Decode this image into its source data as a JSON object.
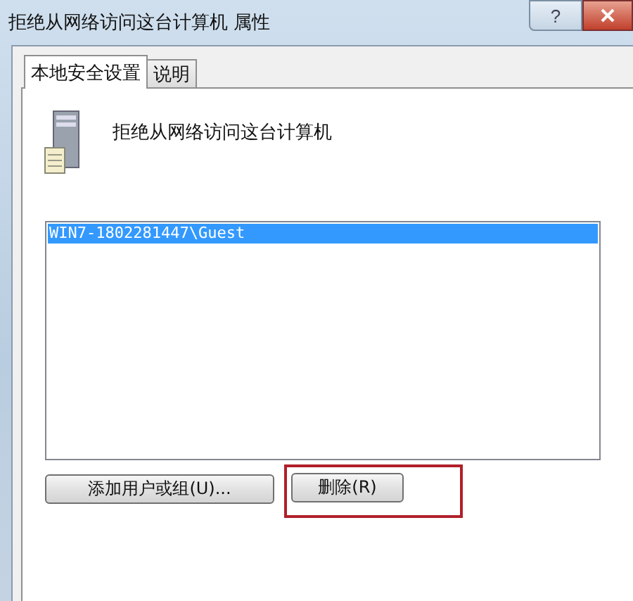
{
  "window": {
    "title": "拒绝从网络访问这台计算机 属性",
    "help_button": "?"
  },
  "tabs": [
    {
      "label": "本地安全设置",
      "selected": true
    },
    {
      "label": "说明",
      "selected": false
    }
  ],
  "policy": {
    "name": "拒绝从网络访问这台计算机"
  },
  "accounts": [
    {
      "name": "WIN7-1802281447\\Guest",
      "selected": true
    }
  ],
  "buttons": [
    {
      "label": "添加用户或组(U)...",
      "highlighted": false
    },
    {
      "label": "删除(R)",
      "highlighted": true
    }
  ]
}
